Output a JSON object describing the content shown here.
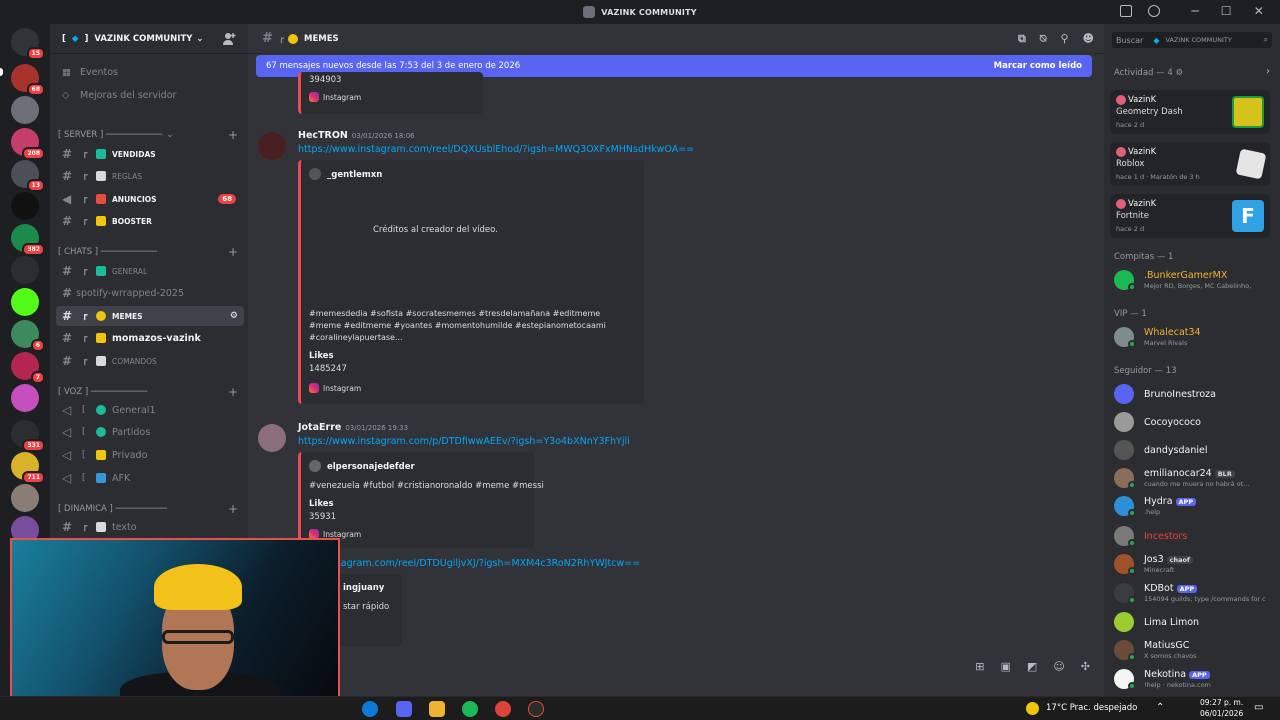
{
  "window": {
    "title": "VAZINK COMMUNITY"
  },
  "server_rail": {
    "badges": [
      "15",
      "68",
      "208",
      "13",
      "382",
      "6",
      "7",
      "331",
      "711"
    ]
  },
  "sidebar": {
    "server_name": "VAZINK COMMUNITY",
    "top_items": [
      {
        "label": "Eventos"
      },
      {
        "label": "Mejoras del servidor"
      }
    ],
    "categories": [
      {
        "label": "[ SERVER ] ───────────"
      },
      {
        "label": "[ CHATS ] ───────────"
      },
      {
        "label": "[ VOZ ] ───────────"
      },
      {
        "label": "[ DINAMICA ] ──────────"
      }
    ],
    "channels": [
      {
        "label": "VENDIDAS",
        "bold": true
      },
      {
        "label": "REGLAS"
      },
      {
        "label": "ANUNCIOS",
        "bold": true,
        "badge": "68"
      },
      {
        "label": "BOOSTER",
        "bold": true
      },
      {
        "label": "GENERAL"
      },
      {
        "label": "spotify-wrrapped-2025"
      },
      {
        "label": "MEMES",
        "active": true
      },
      {
        "label": "momazos-vazink",
        "bold": true
      },
      {
        "label": "COMANDOS"
      },
      {
        "label": "General1"
      },
      {
        "label": "Partidos"
      },
      {
        "label": "Privado"
      },
      {
        "label": "AFK"
      },
      {
        "label": "texto"
      }
    ]
  },
  "chat": {
    "channel_name": "MEMES",
    "new_messages_banner": "67 mensajes nuevos desde las 7:53 del 3 de enero de 2026",
    "mark_read": "Marcar como leído",
    "top_embed": {
      "number": "394903",
      "source": "Instagram"
    },
    "messages": [
      {
        "author": "HecTRON",
        "timestamp": "03/01/2026 18:06",
        "link": "https://www.instagram.com/reel/DQXUsblEhod/?igsh=MWQ3OXFxMHNsdHkwOA==",
        "embed_author": "_gentlemxn",
        "embed_text": "Créditos al creador del vídeo.",
        "embed_tags_1": "#memesdedia #sofista #socratesmemes #tresdelamañana #editmeme",
        "embed_tags_2": "#meme #editmeme #yoantes #momentohumilde #estepianometocaami",
        "embed_tags_3": "#coralineylapuertase...",
        "likes_label": "Likes",
        "likes_value": "1485247",
        "source": "Instagram"
      },
      {
        "author": "JotaErre",
        "timestamp": "03/01/2026 19:33",
        "link": "https://www.instagram.com/p/DTDfiwwAEEv/?igsh=Y3o4bXNnY3FhYjli",
        "embed_author": "elpersonajedefder",
        "embed_text": "#venezuela #futbol #cristianoronaldo #meme #messi",
        "likes_label": "Likes",
        "likes_value": "35931",
        "source": "Instagram"
      },
      {
        "link": "www.instagram.com/reel/DTDUgiljvXJ/?igsh=MXM4c3RoN2RhYWJtcw==",
        "embed_author": "ingjuany",
        "embed_text": "star rápido"
      }
    ]
  },
  "members": {
    "search_placeholder": "Buscar",
    "search_scope": "VAZINK COMMUNITY",
    "activity_header": "Actividad — 4",
    "activities": [
      {
        "user": "VazinK",
        "game": "Geometry Dash",
        "time": "hace 2 d"
      },
      {
        "user": "VazinK",
        "game": "Roblox",
        "time": "hace 1 d  ·  Maratón de 3 h"
      },
      {
        "user": "VazinK",
        "game": "Fortnite",
        "time": "hace 2 d"
      }
    ],
    "groups": [
      {
        "header": "Compitas — 1",
        "members": [
          {
            "name": ".BunkerGamerMX",
            "sub": "Mejor RD, Borges, MC Cabelinho,",
            "color": "#f0b232"
          }
        ]
      },
      {
        "header": "VIP — 1",
        "members": [
          {
            "name": "Whalecat34",
            "sub": "Marvel Rivals",
            "color": "#f0b232"
          }
        ]
      },
      {
        "header": "Seguidor — 13",
        "members": [
          {
            "name": "BrunoInestroza",
            "sub": ""
          },
          {
            "name": "Cocoyococo",
            "sub": ""
          },
          {
            "name": "dandysdaniel",
            "sub": ""
          },
          {
            "name": "emilianocar24",
            "tag": "BLR",
            "sub": "cuando me muera no habrá ot..."
          },
          {
            "name": "Hydra",
            "tag": "APP",
            "sub": ".help"
          },
          {
            "name": "Incestors",
            "sub": "",
            "color": "#f23f43"
          },
          {
            "name": "Jos3",
            "tag": "chaof",
            "sub": "Minecraft"
          },
          {
            "name": "KDBot",
            "tag": "APP",
            "sub": "154094 guilds; type /commands for c"
          },
          {
            "name": "Lima Limon",
            "sub": ""
          },
          {
            "name": "MatiusGC",
            "sub": "X somos chavos"
          },
          {
            "name": "Nekotina",
            "tag": "APP",
            "sub": "!help · nekotina.com"
          }
        ]
      }
    ]
  },
  "taskbar": {
    "weather": "17°C  Prac. despejado",
    "time": "09:27 p. m.",
    "date": "06/01/2026"
  }
}
